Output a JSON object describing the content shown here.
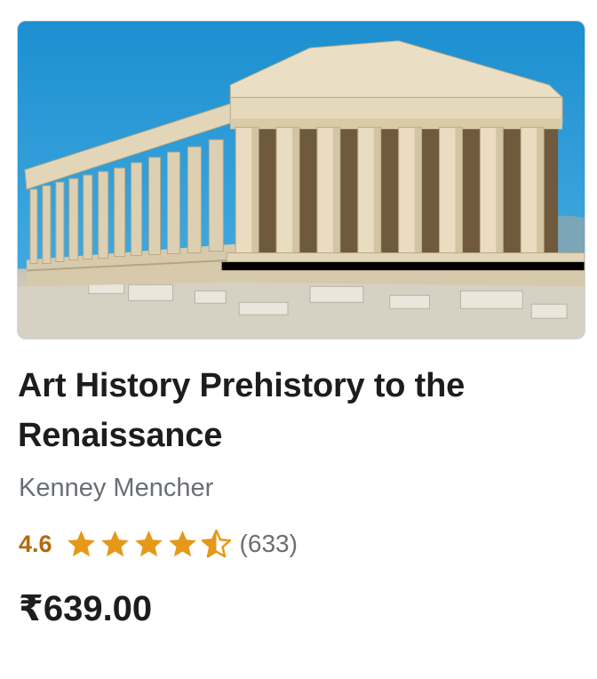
{
  "course": {
    "image_alt": "Parthenon",
    "title": "Art History Prehistory to the Renaissance",
    "instructor": "Kenney Mencher",
    "rating": "4.6",
    "rating_fraction": 0.92,
    "review_count": "(633)",
    "price": "₹639.00"
  },
  "colors": {
    "star": "#e59819",
    "rating_text": "#b4690e",
    "title_text": "#1c1d1f",
    "secondary_text": "#6a6f73"
  },
  "icons": {
    "star_full": "star-icon",
    "star_half": "star-half-icon"
  }
}
